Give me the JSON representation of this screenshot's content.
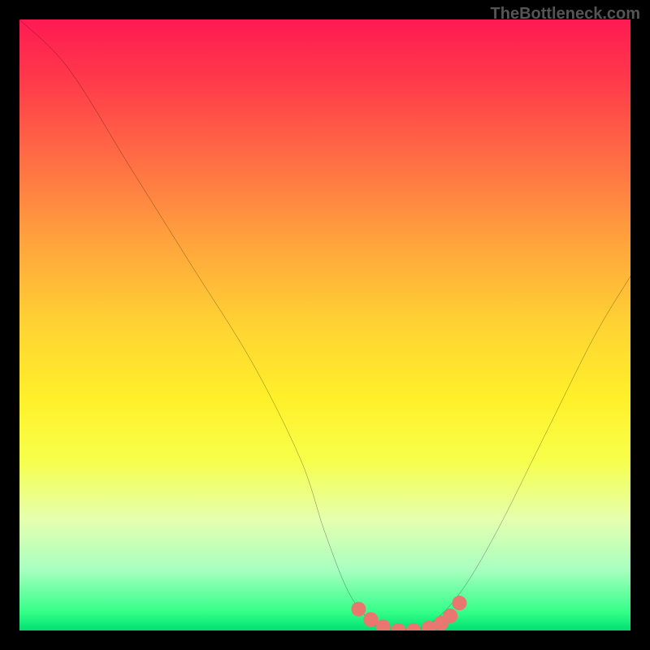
{
  "attribution": "TheBottleneck.com",
  "chart_data": {
    "type": "line",
    "title": "",
    "xlabel": "",
    "ylabel": "",
    "xlim": [
      0,
      100
    ],
    "ylim": [
      0,
      100
    ],
    "series": [
      {
        "name": "curve",
        "x": [
          0,
          8,
          18,
          28,
          38,
          46,
          50,
          54,
          58,
          60,
          63,
          67,
          72,
          78,
          86,
          94,
          100
        ],
        "y": [
          100,
          92,
          76,
          60,
          44,
          28,
          16,
          6,
          1,
          0,
          0,
          1,
          6,
          16,
          32,
          48,
          58
        ]
      }
    ],
    "markers": {
      "name": "highlight-points",
      "color": "#e9766f",
      "x": [
        55.5,
        57.5,
        59.5,
        62,
        64.5,
        67,
        69,
        70.5,
        72
      ],
      "y": [
        3.5,
        1.8,
        0.6,
        0,
        0,
        0.4,
        1.2,
        2.4,
        4.5
      ]
    },
    "gradient_colors": {
      "top": "#ff1a53",
      "mid": "#ffd333",
      "bottom": "#00e070"
    }
  }
}
